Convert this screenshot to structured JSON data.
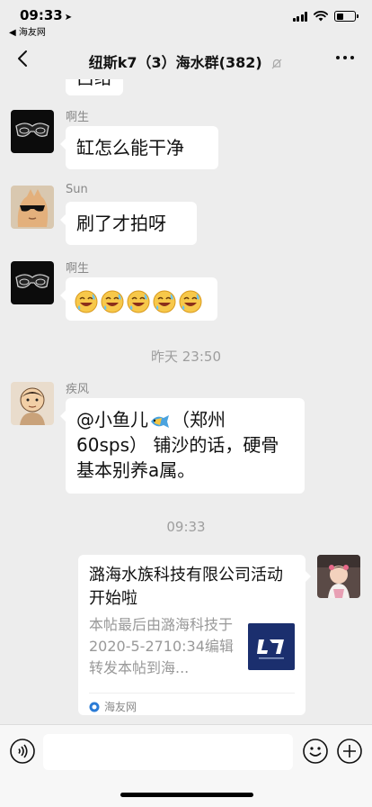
{
  "status_bar": {
    "time": "09:33",
    "back_app": "◀ 海友网"
  },
  "nav": {
    "title": "纽斯k7（3）海水群(382)"
  },
  "messages": {
    "partial_text": "吕给",
    "m1": {
      "sender": "啊生",
      "text": "缸怎么能干净"
    },
    "m2": {
      "sender": "Sun",
      "text": "刷了才拍呀"
    },
    "m3": {
      "sender": "啊生",
      "emoji_count": 5,
      "emoji_icon": "grinning-sweat-face-emoji"
    },
    "ts1": "昨天 23:50",
    "m4": {
      "sender": "疾风",
      "text_before": "@小鱼儿",
      "text_after": "（郑州60sps） 铺沙的话，硬骨基本别养a属。"
    },
    "ts2": "09:33",
    "card": {
      "title": "潞海水族科技有限公司活动开始啦",
      "desc": "本帖最后由潞海科技于2020-5-2710:34编辑转发本帖到海...",
      "source": "海友网"
    }
  },
  "input": {
    "placeholder": ""
  }
}
